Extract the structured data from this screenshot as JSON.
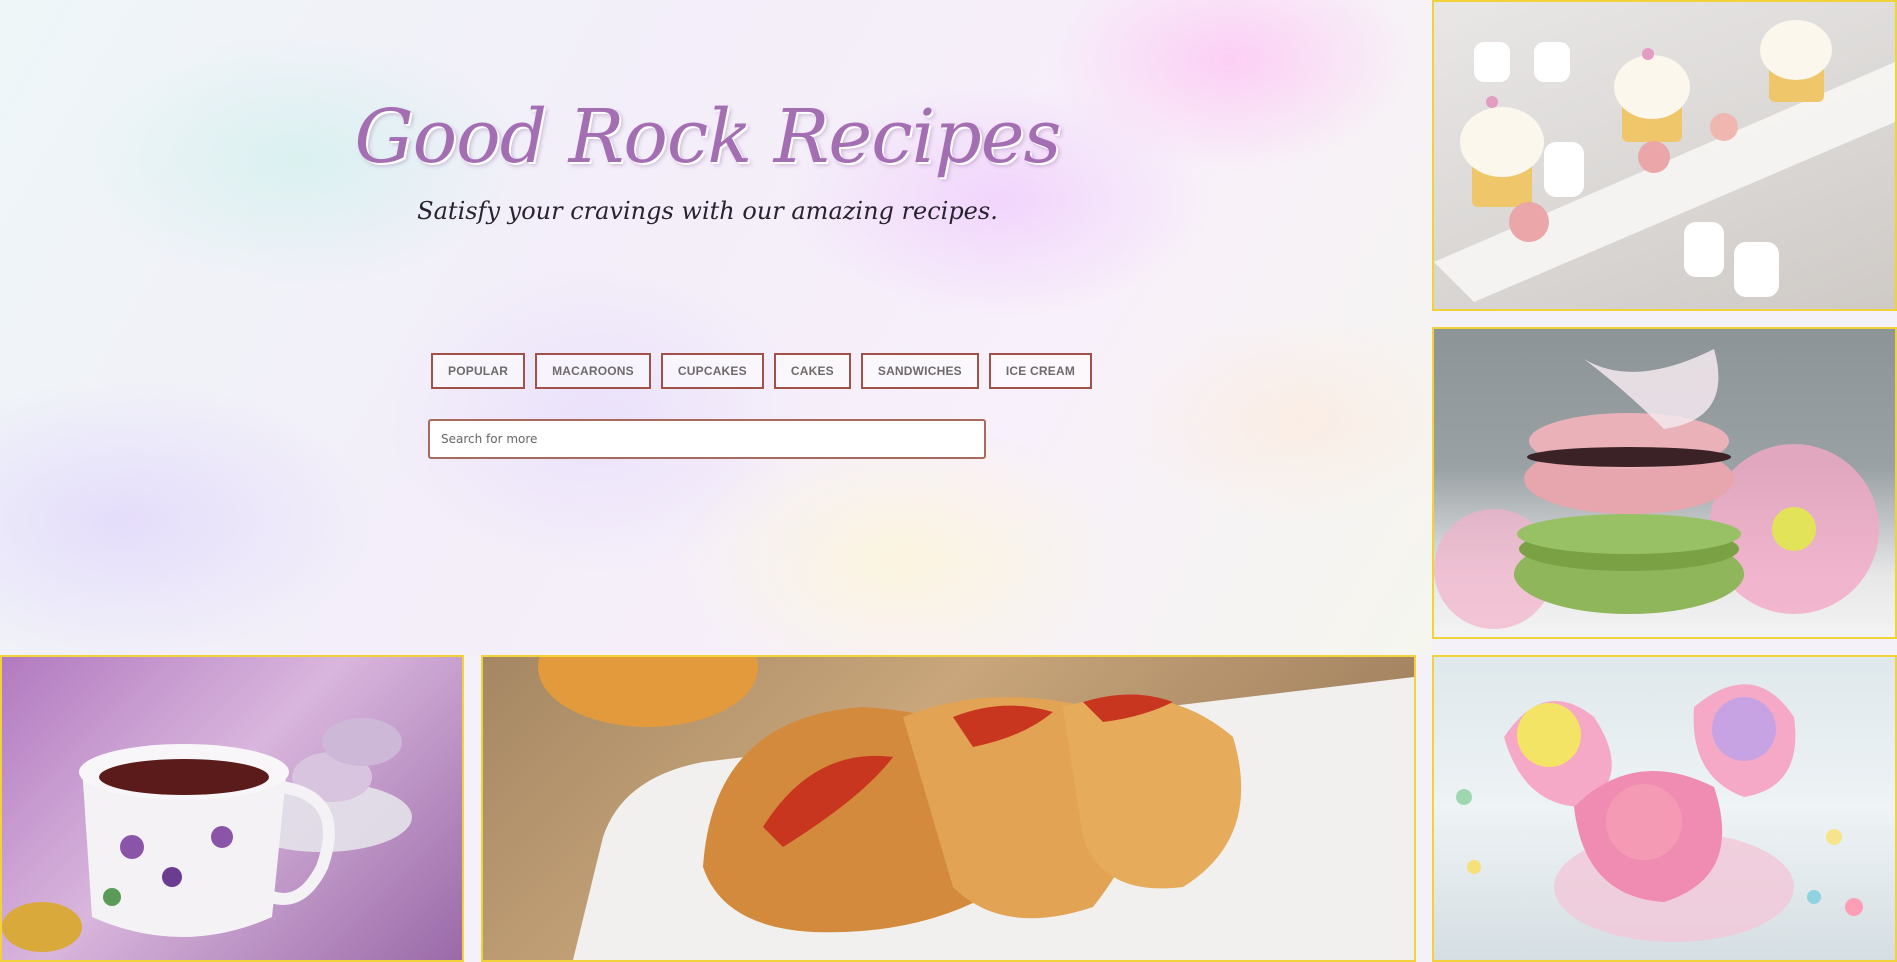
{
  "site": {
    "title": "Good Rock Recipes",
    "tagline": "Satisfy your cravings with our amazing recipes."
  },
  "nav": {
    "items": [
      {
        "label": "POPULAR"
      },
      {
        "label": "MACAROONS"
      },
      {
        "label": "CUPCAKES"
      },
      {
        "label": "CAKES"
      },
      {
        "label": "SANDWICHES"
      },
      {
        "label": "ICE CREAM"
      }
    ]
  },
  "search": {
    "placeholder": "Search for more",
    "value": ""
  },
  "colors": {
    "title": "#a46eb3",
    "button_border": "#a0524a",
    "photo_border": "#f1d23a"
  }
}
